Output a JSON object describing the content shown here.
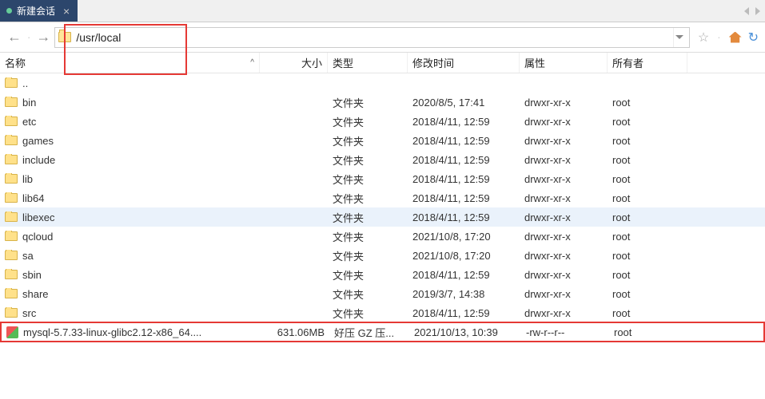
{
  "tab": {
    "title": "新建会话"
  },
  "address": {
    "path": "/usr/local"
  },
  "columns": {
    "name": "名称",
    "size": "大小",
    "type": "类型",
    "mtime": "修改时间",
    "attr": "属性",
    "owner": "所有者"
  },
  "rows": [
    {
      "icon": "folder",
      "name": "..",
      "size": "",
      "type": "",
      "mtime": "",
      "attr": "",
      "owner": "",
      "hl": false
    },
    {
      "icon": "folder",
      "name": "bin",
      "size": "",
      "type": "文件夹",
      "mtime": "2020/8/5, 17:41",
      "attr": "drwxr-xr-x",
      "owner": "root",
      "hl": false
    },
    {
      "icon": "folder",
      "name": "etc",
      "size": "",
      "type": "文件夹",
      "mtime": "2018/4/11, 12:59",
      "attr": "drwxr-xr-x",
      "owner": "root",
      "hl": false
    },
    {
      "icon": "folder",
      "name": "games",
      "size": "",
      "type": "文件夹",
      "mtime": "2018/4/11, 12:59",
      "attr": "drwxr-xr-x",
      "owner": "root",
      "hl": false
    },
    {
      "icon": "folder",
      "name": "include",
      "size": "",
      "type": "文件夹",
      "mtime": "2018/4/11, 12:59",
      "attr": "drwxr-xr-x",
      "owner": "root",
      "hl": false
    },
    {
      "icon": "folder",
      "name": "lib",
      "size": "",
      "type": "文件夹",
      "mtime": "2018/4/11, 12:59",
      "attr": "drwxr-xr-x",
      "owner": "root",
      "hl": false
    },
    {
      "icon": "folder",
      "name": "lib64",
      "size": "",
      "type": "文件夹",
      "mtime": "2018/4/11, 12:59",
      "attr": "drwxr-xr-x",
      "owner": "root",
      "hl": false
    },
    {
      "icon": "folder",
      "name": "libexec",
      "size": "",
      "type": "文件夹",
      "mtime": "2018/4/11, 12:59",
      "attr": "drwxr-xr-x",
      "owner": "root",
      "hl": true
    },
    {
      "icon": "folder",
      "name": "qcloud",
      "size": "",
      "type": "文件夹",
      "mtime": "2021/10/8, 17:20",
      "attr": "drwxr-xr-x",
      "owner": "root",
      "hl": false
    },
    {
      "icon": "folder",
      "name": "sa",
      "size": "",
      "type": "文件夹",
      "mtime": "2021/10/8, 17:20",
      "attr": "drwxr-xr-x",
      "owner": "root",
      "hl": false
    },
    {
      "icon": "folder",
      "name": "sbin",
      "size": "",
      "type": "文件夹",
      "mtime": "2018/4/11, 12:59",
      "attr": "drwxr-xr-x",
      "owner": "root",
      "hl": false
    },
    {
      "icon": "folder",
      "name": "share",
      "size": "",
      "type": "文件夹",
      "mtime": "2019/3/7, 14:38",
      "attr": "drwxr-xr-x",
      "owner": "root",
      "hl": false
    },
    {
      "icon": "folder",
      "name": "src",
      "size": "",
      "type": "文件夹",
      "mtime": "2018/4/11, 12:59",
      "attr": "drwxr-xr-x",
      "owner": "root",
      "hl": false
    },
    {
      "icon": "archive",
      "name": "mysql-5.7.33-linux-glibc2.12-x86_64....",
      "size": "631.06MB",
      "type": "好压 GZ 压...",
      "mtime": "2021/10/13, 10:39",
      "attr": "-rw-r--r--",
      "owner": "root",
      "hl": false,
      "redbox": true
    }
  ]
}
